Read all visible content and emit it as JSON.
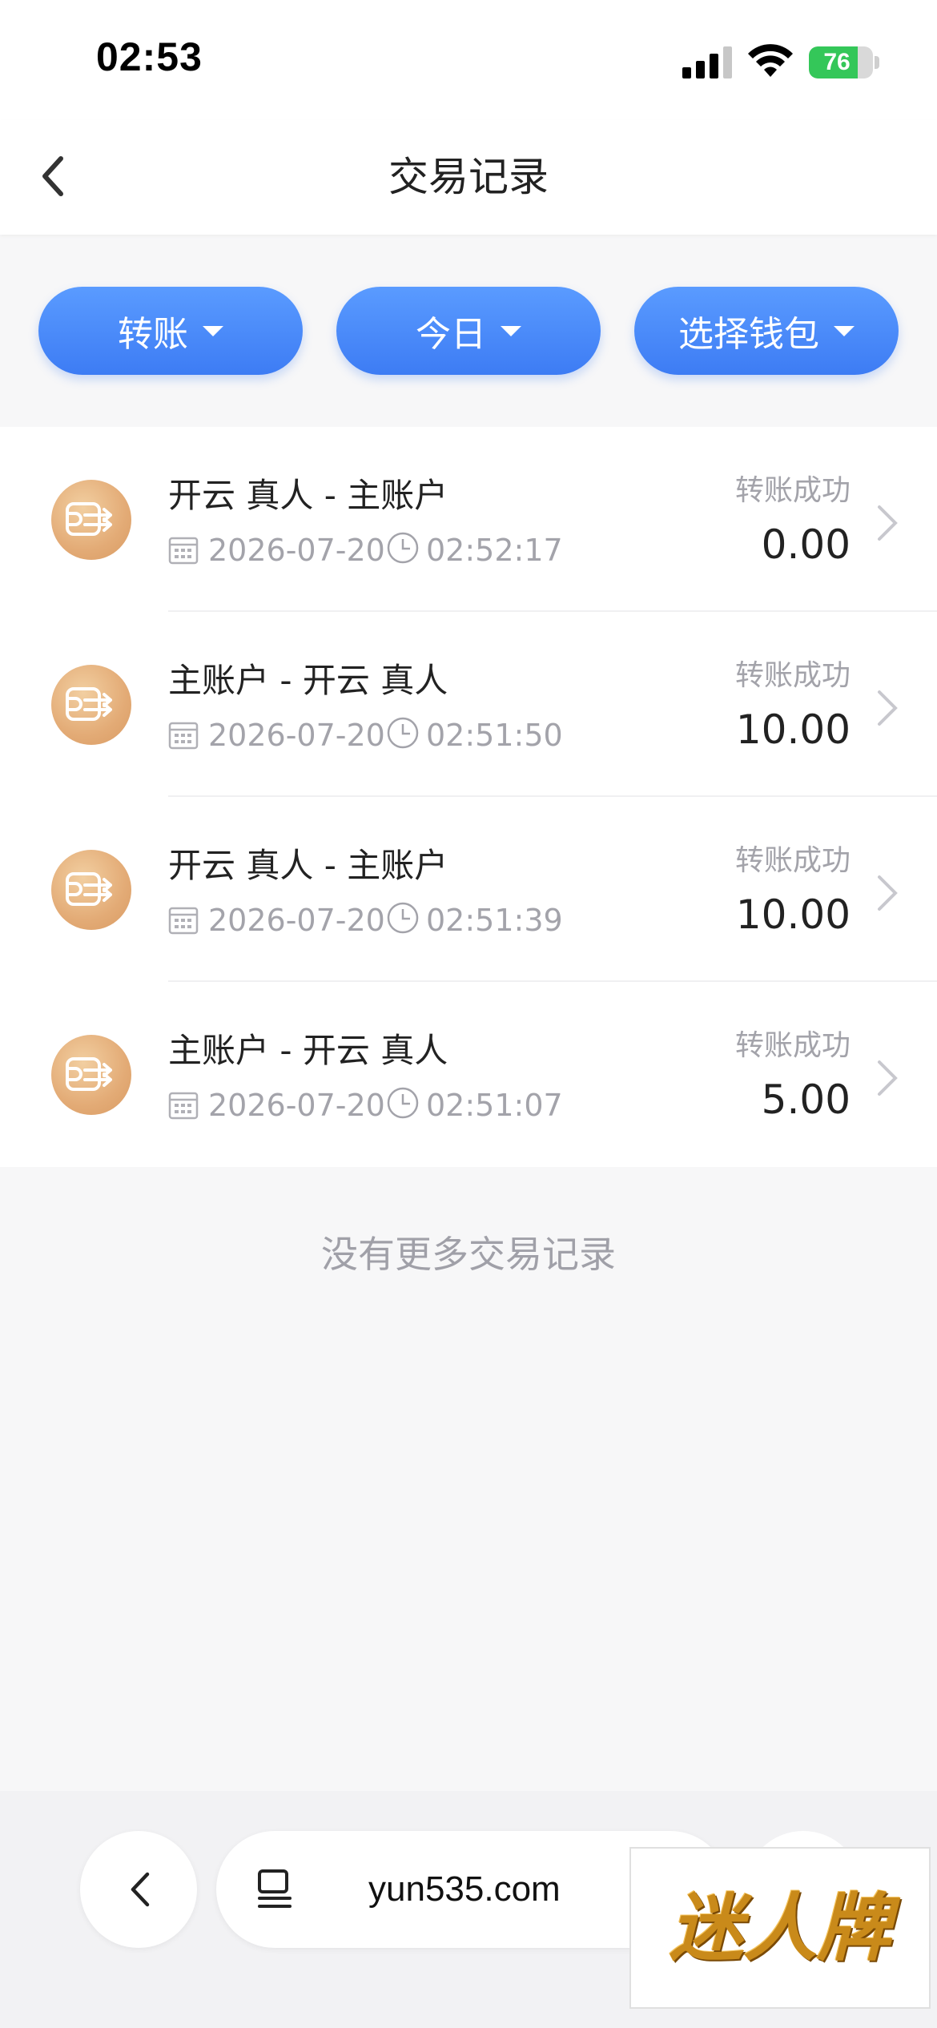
{
  "status_bar": {
    "time": "02:53",
    "battery_level": 76,
    "battery_label": "76"
  },
  "header": {
    "title": "交易记录",
    "back_icon": "chevron-left-icon"
  },
  "filters": [
    {
      "label": "转账"
    },
    {
      "label": "今日"
    },
    {
      "label": "选择钱包"
    }
  ],
  "transactions": [
    {
      "title": "开云 真人 - 主账户",
      "date": "2026-07-20",
      "time": "02:52:17",
      "status": "转账成功",
      "amount": "0.00"
    },
    {
      "title": "主账户 - 开云 真人",
      "date": "2026-07-20",
      "time": "02:51:50",
      "status": "转账成功",
      "amount": "10.00"
    },
    {
      "title": "开云 真人 - 主账户",
      "date": "2026-07-20",
      "time": "02:51:39",
      "status": "转账成功",
      "amount": "10.00"
    },
    {
      "title": "主账户 - 开云 真人",
      "date": "2026-07-20",
      "time": "02:51:07",
      "status": "转账成功",
      "amount": "5.00"
    }
  ],
  "footer_note": "没有更多交易记录",
  "browser": {
    "url": "yun535.com"
  },
  "watermark": "迷人牌",
  "colors": {
    "accent": "#3d7cf4",
    "icon_gold": "#e3ab76",
    "muted_text": "#a3a3aa"
  }
}
